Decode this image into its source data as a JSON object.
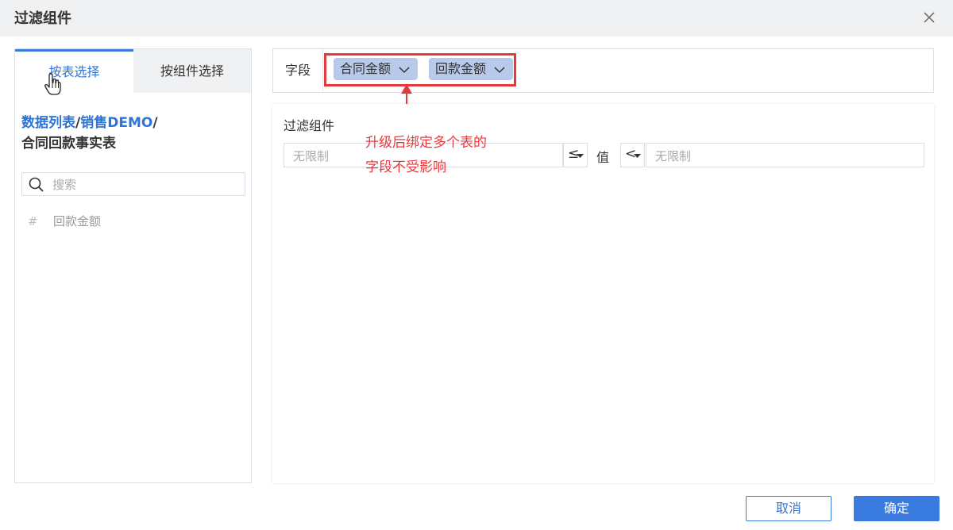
{
  "dialog": {
    "title": "过滤组件"
  },
  "left_panel": {
    "tabs": [
      {
        "label": "按表选择"
      },
      {
        "label": "按组件选择"
      }
    ],
    "breadcrumb": {
      "part1": "数据列表",
      "sep1": "/",
      "part2": "销售DEMO",
      "sep2": "/",
      "part3": "合同回款事实表"
    },
    "search": {
      "placeholder": "搜索",
      "value": ""
    },
    "fields": [
      {
        "icon": "#",
        "label": "回款金额"
      }
    ]
  },
  "field_row": {
    "label": "字段",
    "chips": [
      {
        "label": "合同金额"
      },
      {
        "label": "回款金额"
      }
    ]
  },
  "filter": {
    "label": "过滤组件",
    "min_placeholder": "无限制",
    "op1": "≤",
    "value_label": "值",
    "op2": "<",
    "max_placeholder": "无限制"
  },
  "annotation": {
    "line1": "升级后绑定多个表的",
    "line2": "字段不受影响"
  },
  "footer": {
    "cancel_label": "取消",
    "ok_label": "确定"
  },
  "colors": {
    "accent": "#3a7be0",
    "highlight_red": "#e5393e",
    "chip_bg": "#b9c9ea"
  }
}
